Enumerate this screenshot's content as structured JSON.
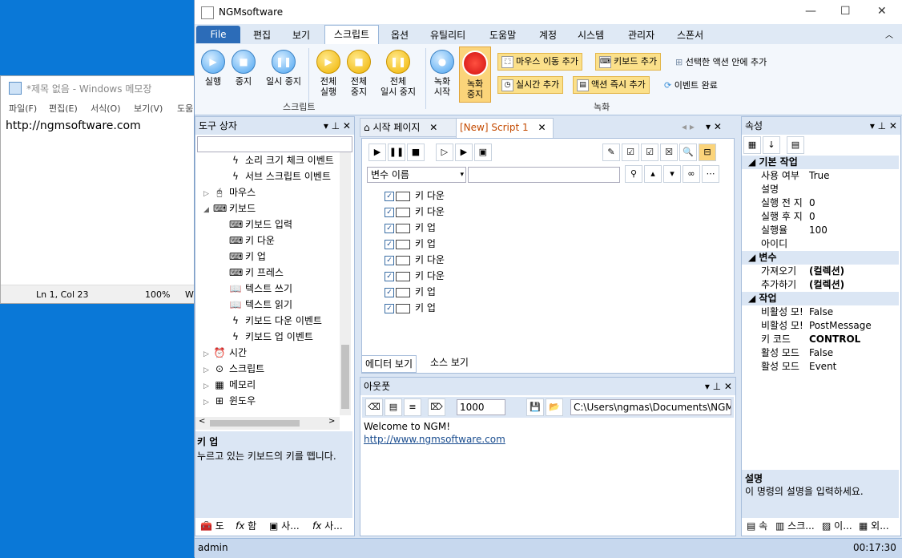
{
  "notepad": {
    "title": "*제목 없음 - Windows 메모장",
    "menu": [
      "파일(F)",
      "편집(E)",
      "서식(O)",
      "보기(V)",
      "도움"
    ],
    "content": "http://ngmsoftware.com",
    "status_pos": "Ln 1, Col 23",
    "status_zoom": "100%",
    "status_enc": "W"
  },
  "app": {
    "title": "NGMsoftware",
    "menu_tabs": [
      "File",
      "편집",
      "보기",
      "스크립트",
      "옵션",
      "유틸리티",
      "도움말",
      "계정",
      "시스템",
      "관리자",
      "스폰서"
    ],
    "ribbon": {
      "run": "실행",
      "stop": "중지",
      "pause": "일시 중지",
      "run_all_1": "전체",
      "run_all_2": "실행",
      "stop_all_1": "전체",
      "stop_all_2": "중지",
      "pause_all_1": "전체",
      "pause_all_2": "일시 중지",
      "rec_start_1": "녹화",
      "rec_start_2": "시작",
      "rec_stop_1": "녹화",
      "rec_stop_2": "중지",
      "add_mouse": "마우스 이동 추가",
      "add_keyboard": "키보드 추가",
      "add_in_selected": "선택한 액션 안에 추가",
      "add_realtime": "실시간 추가",
      "add_action_now": "액션 즉시 추가",
      "event_done": "이벤트 완료",
      "group_script": "스크립트",
      "group_record": "녹화"
    },
    "toolbox": {
      "title": "도구 상자",
      "items": [
        {
          "label": "소리 크기 체크 이벤트",
          "icon": "bolt-icon"
        },
        {
          "label": "서브 스크립트 이벤트",
          "icon": "bolt-icon"
        },
        {
          "label": "마우스",
          "icon": "mouse-icon"
        },
        {
          "label": "키보드",
          "icon": "keyboard-icon"
        },
        {
          "label": "키보드 입력",
          "icon": "keyboard-icon"
        },
        {
          "label": "키 다운",
          "icon": "keyboard-icon"
        },
        {
          "label": "키 업",
          "icon": "keyboard-icon"
        },
        {
          "label": "키 프레스",
          "icon": "keyboard-icon"
        },
        {
          "label": "텍스트 쓰기",
          "icon": "book-icon"
        },
        {
          "label": "텍스트 읽기",
          "icon": "book-icon"
        },
        {
          "label": "키보드 다운 이벤트",
          "icon": "bolt-icon"
        },
        {
          "label": "키보드 업 이벤트",
          "icon": "bolt-icon"
        },
        {
          "label": "시간",
          "icon": "clock-icon"
        },
        {
          "label": "스크립트",
          "icon": "script-icon"
        },
        {
          "label": "메모리",
          "icon": "memory-icon"
        },
        {
          "label": "윈도우",
          "icon": "windows-icon"
        }
      ],
      "desc_title": "키 업",
      "desc_text": "누르고 있는 키보드의 키를 뗍니다.",
      "bottom_tabs": [
        "도",
        "함",
        "사...",
        "사..."
      ]
    },
    "editor": {
      "tab_start": "시작 페이지",
      "tab_script": "[New] Script 1",
      "var_select": "변수 이름",
      "rows": [
        "키 다운",
        "키 다운",
        "키 업",
        "키 업",
        "키 다운",
        "키 다운",
        "키 업",
        "키 업"
      ],
      "tab_editor": "에디터 보기",
      "tab_source": "소스 보기"
    },
    "output": {
      "title": "아웃풋",
      "count": "1000",
      "path": "C:\\Users\\ngmas\\Documents\\NGM6\\",
      "line1": "Welcome to NGM!",
      "line2": "http://www.ngmsoftware.com"
    },
    "properties": {
      "title": "속성",
      "cat_basic": "기본 작업",
      "basic": [
        {
          "k": "사용 여부",
          "v": "True"
        },
        {
          "k": "설명",
          "v": ""
        },
        {
          "k": "실행 전 지",
          "v": "0"
        },
        {
          "k": "실행 후 지",
          "v": "0"
        },
        {
          "k": "실행율",
          "v": "100"
        },
        {
          "k": "아이디",
          "v": ""
        }
      ],
      "cat_var": "변수",
      "vars": [
        {
          "k": "가져오기",
          "v": "(컬렉션)"
        },
        {
          "k": "추가하기",
          "v": "(컬렉션)"
        }
      ],
      "cat_work": "작업",
      "work": [
        {
          "k": "비활성 모!",
          "v": "False"
        },
        {
          "k": "비활성 모!",
          "v": "PostMessage"
        },
        {
          "k": "키 코드",
          "v": "CONTROL"
        },
        {
          "k": "활성 모드",
          "v": "False"
        },
        {
          "k": "활성 모드",
          "v": "Event"
        }
      ],
      "desc_title": "설명",
      "desc_text": "이 명령의 설명을 입력하세요.",
      "bottom_tabs": [
        "속",
        "스크...",
        "이...",
        "외..."
      ]
    },
    "status": {
      "user": "admin",
      "time": "00:17:30"
    }
  }
}
